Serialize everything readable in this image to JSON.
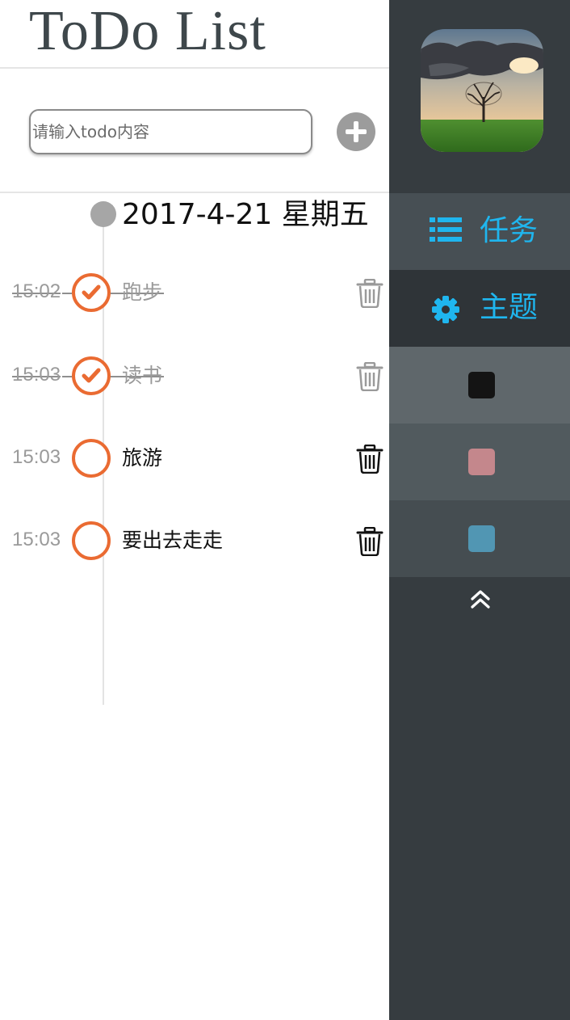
{
  "header": {
    "title": "ToDo List"
  },
  "input": {
    "placeholder": "请输入todo内容",
    "value": ""
  },
  "date_group": {
    "date_label": "2017-4-21 星期五"
  },
  "todos": [
    {
      "time": "15:02",
      "text": "跑步",
      "done": true
    },
    {
      "time": "15:03",
      "text": "读书",
      "done": true
    },
    {
      "time": "15:03",
      "text": "旅游",
      "done": false
    },
    {
      "time": "15:03",
      "text": "要出去走走",
      "done": false
    }
  ],
  "sidebar": {
    "menu": [
      {
        "label": "任务",
        "icon": "list-icon",
        "active": false
      },
      {
        "label": "主题",
        "icon": "gear-icon",
        "active": true
      }
    ],
    "themes": [
      {
        "name": "black",
        "color": "#141414"
      },
      {
        "name": "pink",
        "color": "#c4878c"
      },
      {
        "name": "blue",
        "color": "#5196b3"
      }
    ],
    "collapse_icon": "double-chevron-up-icon"
  },
  "colors": {
    "accent_orange": "#ea6b32",
    "menu_text_blue": "#1fb6ef",
    "sidebar_bg": "#363c40",
    "muted_gray": "#9a9a9a"
  }
}
